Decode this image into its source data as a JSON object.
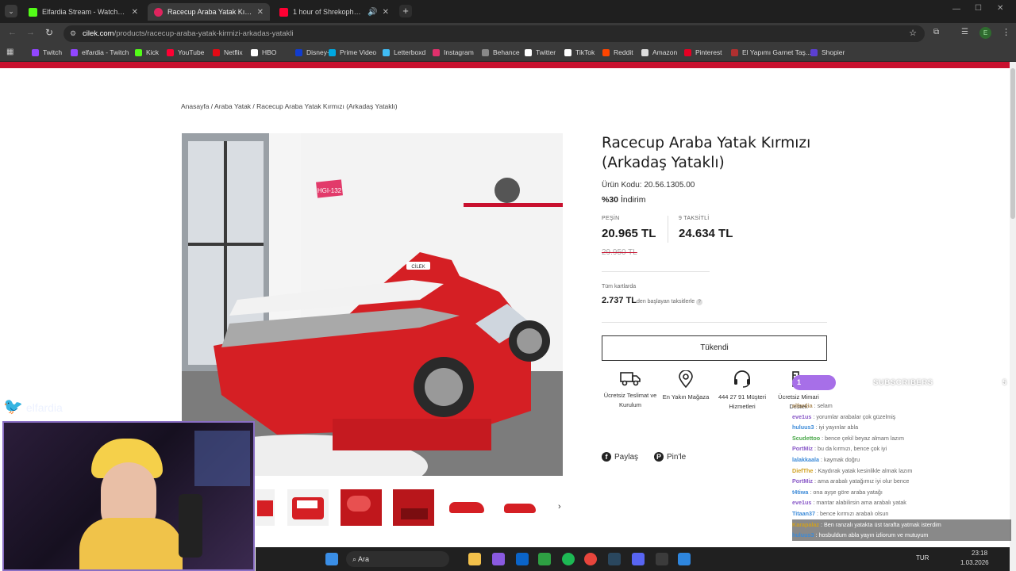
{
  "browser": {
    "tabs": [
      {
        "title": "Elfardia Stream - Watch Live o...",
        "color": "#53fc18"
      },
      {
        "title": "Racecup Araba Yatak Kırmızı (Ar...",
        "color": "#e0245e"
      },
      {
        "title": "1 hour of Shrekophone -",
        "color": "#ff0033"
      }
    ],
    "url_domain": "cilek.com",
    "url_path": "/products/racecup-araba-yatak-kirmizi-arkadas-yatakli",
    "profile_initial": "E",
    "bookmarks": [
      {
        "label": "Twitch",
        "color": "#9146ff"
      },
      {
        "label": "elfardia - Twitch",
        "color": "#9146ff"
      },
      {
        "label": "Kick",
        "color": "#53fc18"
      },
      {
        "label": "YouTube",
        "color": "#ff0033"
      },
      {
        "label": "Netflix",
        "color": "#e50914"
      },
      {
        "label": "HBO",
        "color": "#ffffff"
      },
      {
        "label": "Disney+",
        "color": "#113ccf"
      },
      {
        "label": "Prime Video",
        "color": "#00a8e1"
      },
      {
        "label": "Letterboxd",
        "color": "#40bcf4"
      },
      {
        "label": "Instagram",
        "color": "#e1306c"
      },
      {
        "label": "Behance",
        "color": "#888888"
      },
      {
        "label": "Twitter",
        "color": "#ffffff"
      },
      {
        "label": "TikTok",
        "color": "#ffffff"
      },
      {
        "label": "Reddit",
        "color": "#ff4500"
      },
      {
        "label": "Amazon",
        "color": "#dddddd"
      },
      {
        "label": "Pinterest",
        "color": "#e60023"
      },
      {
        "label": "El Yapımı Garnet Taş...",
        "color": "#b03030"
      },
      {
        "label": "Shopier",
        "color": "#5b3fd1"
      }
    ]
  },
  "page": {
    "breadcrumb": "Anasayfa / Araba Yatak / Racecup Araba Yatak Kırmızı (Arkadaş Yataklı)",
    "product_title": "Racecup Araba Yatak Kırmızı (Arkadaş Yataklı)",
    "product_code": "Ürün Kodu: 20.56.1305.00",
    "discount_value": "%30",
    "discount_word": "İndirim",
    "cash_label": "PEŞİN",
    "cash_price": "20.965 TL",
    "installment_label": "9 TAKSİTLİ",
    "installment_price": "24.634 TL",
    "old_price": "29.950 TL",
    "cards_text": "Tüm kartlarda",
    "monthly_amount": "2.737 TL",
    "monthly_suffix": "den başlayan taksitlerle",
    "soldout_button": "Tükendi",
    "features": [
      {
        "icon": "truck-icon",
        "text": "Ücretsiz Teslimat ve Kurulum"
      },
      {
        "icon": "location-pin-icon",
        "text": "En Yakın Mağaza"
      },
      {
        "icon": "headset-icon",
        "text": "444 27 91 Müşteri Hizmetleri"
      },
      {
        "icon": "ruler-icon",
        "text": "Ücretsiz Mimari Destek"
      }
    ],
    "share_label": "Paylaş",
    "pin_label": "Pin'le",
    "bed_plate": "CİLEK",
    "sign_text": "HGI-132"
  },
  "overlay": {
    "twitter_handle": "elfardia",
    "subscribers_label": "SUBSCRIBERS",
    "subscribers_current": "1",
    "subscribers_goal": "5",
    "chat": [
      {
        "user": "elfardia",
        "msg": "selam",
        "color": "#b09060"
      },
      {
        "user": "eve1us",
        "msg": "yorumlar arabalar çok güzelmiş",
        "color": "#8a5ac8"
      },
      {
        "user": "huluus3",
        "msg": "iyi yayınlar abla",
        "color": "#3d8bd8"
      },
      {
        "user": "Scudettoo",
        "msg": "bence çekil beyaz almam lazım",
        "color": "#4aa84a"
      },
      {
        "user": "PortMiz",
        "msg": "bu da kırmızı, bence çok iyi",
        "color": "#8a5ac8"
      },
      {
        "user": "lalakkaala",
        "msg": "kaymak doğru",
        "color": "#3d8bd8"
      },
      {
        "user": "DiefThe",
        "msg": "Kaydırak yatak kesinlikle almak lazım",
        "color": "#d0a020"
      },
      {
        "user": "PortMiz",
        "msg": "ama arabalı yatağımız iyi olur bence",
        "color": "#8a5ac8"
      },
      {
        "user": "t4tiwa",
        "msg": "ona ayşe göre araba yatağı",
        "color": "#3d8bd8"
      },
      {
        "user": "eve1us",
        "msg": "mantar alabilirsin ama arabalı yatak",
        "color": "#8a5ac8"
      },
      {
        "user": "Titaan37",
        "msg": "bence kırmızı arabalı olsun",
        "color": "#3d8bd8"
      },
      {
        "user": "Karapalaz",
        "msg": "Ben ranzalı yatakta üst tarafta yatmak isterdim",
        "color": "#d0a020"
      },
      {
        "user": "huluus3",
        "msg": "hosbuldum abla yayın izliorum ve mutuyum",
        "color": "#3d8bd8"
      }
    ]
  },
  "taskbar": {
    "search_label": "Ara",
    "lang": "TUR",
    "time": "23:18",
    "date": "1.03.2026"
  }
}
